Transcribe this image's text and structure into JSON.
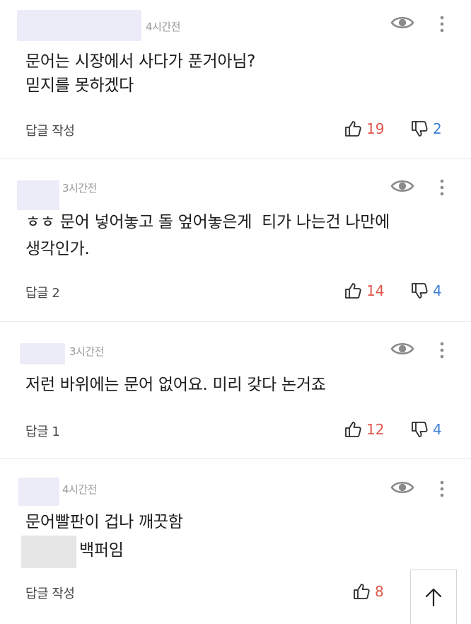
{
  "comments": [
    {
      "time": "4시간전",
      "text_lines": [
        "문어는 시장에서 사다가 푼거아님?",
        "믿지를 못하겠다"
      ],
      "reply_label": "답글 작성",
      "likes": "19",
      "dislikes": "2"
    },
    {
      "time": "3시간전",
      "text_lines": [
        "ㅎㅎ 문어 넣어놓고 돌 엎어놓은게  티가 나는건 나만에",
        "생각인가."
      ],
      "reply_label": "답글 2",
      "likes": "14",
      "dislikes": "4"
    },
    {
      "time": "3시간전",
      "text_lines": [
        "저런 바위에는 문어 없어요. 미리 갖다 논거죠"
      ],
      "reply_label": "답글 1",
      "likes": "12",
      "dislikes": "4"
    },
    {
      "time": "4시간전",
      "text_lines": [
        "문어빨판이 겁나 깨끗함",
        "백퍼임"
      ],
      "reply_label": "답글 작성",
      "likes": "8",
      "dislikes": ""
    }
  ],
  "colors": {
    "like": "#e0574b",
    "dislike": "#3d7fd6",
    "name_blur": "#ecebf8"
  },
  "icons": {
    "view": "eye-icon",
    "menu": "more-vertical-icon",
    "like": "thumbs-up-icon",
    "dislike": "thumbs-down-icon",
    "scroll_top": "arrow-up-icon"
  }
}
